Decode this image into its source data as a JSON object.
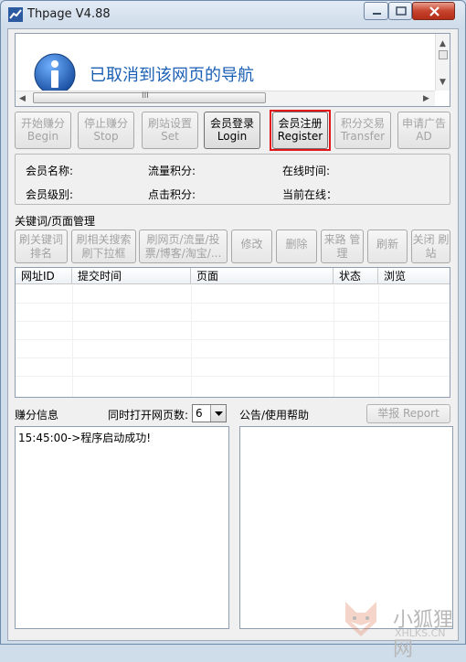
{
  "window": {
    "title": "Thpage V4.88"
  },
  "browser": {
    "message": "已取消到该网页的导航",
    "hthumb_grip": "III"
  },
  "toolbar": {
    "begin": {
      "cn": "开始赚分",
      "en": "Begin"
    },
    "stop": {
      "cn": "停止赚分",
      "en": "Stop"
    },
    "set": {
      "cn": "刷站设置",
      "en": "Set"
    },
    "login": {
      "cn": "会员登录",
      "en": "Login"
    },
    "register": {
      "cn": "会员注册",
      "en": "Register"
    },
    "transfer": {
      "cn": "积分交易",
      "en": "Transfer"
    },
    "ad": {
      "cn": "申请广告",
      "en": "AD"
    }
  },
  "member": {
    "name_label": "会员名称:",
    "flow_points_label": "流量积分:",
    "online_time_label": "在线时间:",
    "level_label": "会员级别:",
    "click_points_label": "点击积分:",
    "current_online_label": "当前在线："
  },
  "keywords": {
    "title": "关键词/页面管理",
    "buttons": [
      {
        "l1": "刷关键词",
        "l2": "排名"
      },
      {
        "l1": "刷相关搜索",
        "l2": "刷下拉框"
      },
      {
        "l1": "刷网页/流量/投",
        "l2": "票/博客/淘宝/..."
      },
      {
        "l1": "修改",
        "l2": ""
      },
      {
        "l1": "删除",
        "l2": ""
      },
      {
        "l1": "来路",
        "l2": "管理"
      },
      {
        "l1": "刷新",
        "l2": ""
      },
      {
        "l1": "关闭",
        "l2": "刷站"
      }
    ],
    "columns": [
      "网址ID",
      "提交时间",
      "页面",
      "状态",
      "浏览"
    ]
  },
  "earn": {
    "title": "赚分信息",
    "concurrent_label": "同时打开网页数:",
    "concurrent_value": "6",
    "log": "15:45:00->程序启动成功!"
  },
  "help": {
    "title": "公告/使用帮助",
    "report_button": "举报 Report"
  },
  "watermark": {
    "brand": "小狐狸网",
    "domain": "XHLKS.CN"
  },
  "colors": {
    "info_blue": "#1a5fb4",
    "highlight_red": "#e2171b",
    "close_red": "#c7432d"
  }
}
